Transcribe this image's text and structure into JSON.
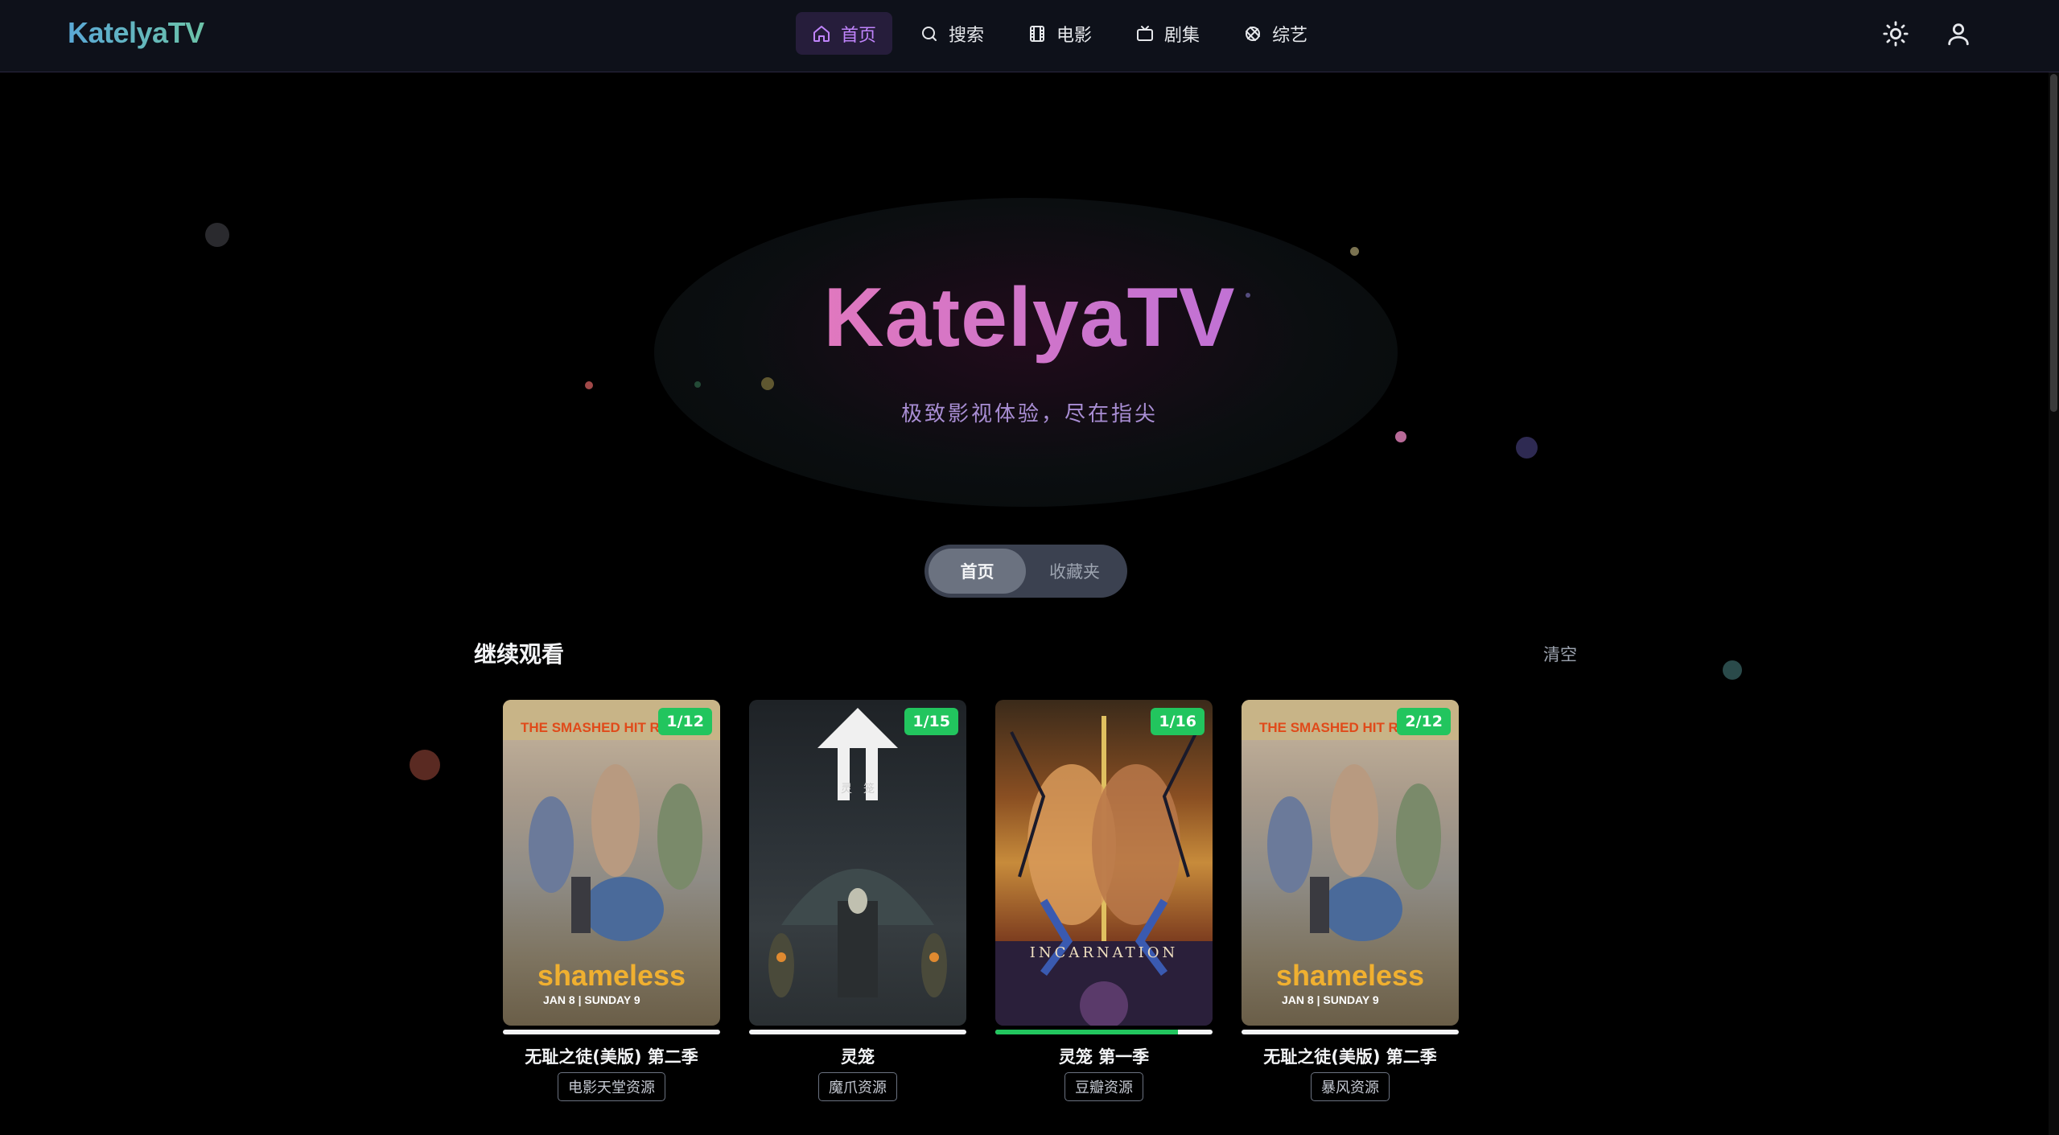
{
  "app": {
    "logo": "KatelyaTV"
  },
  "nav": {
    "items": [
      {
        "label": "首页",
        "icon": "home-icon",
        "active": true
      },
      {
        "label": "搜索",
        "icon": "search-icon",
        "active": false
      },
      {
        "label": "电影",
        "icon": "film-icon",
        "active": false
      },
      {
        "label": "剧集",
        "icon": "tv-icon",
        "active": false
      },
      {
        "label": "综艺",
        "icon": "variety-icon",
        "active": false
      }
    ],
    "theme_icon": "sun-icon",
    "user_icon": "user-icon"
  },
  "hero": {
    "title": "KatelyaTV",
    "subtitle": "极致影视体验，尽在指尖"
  },
  "tabs": {
    "home": "首页",
    "favorites": "收藏夹",
    "active": "home"
  },
  "continue_watching": {
    "title": "继续观看",
    "clear_label": "清空",
    "items": [
      {
        "title": "无耻之徒(美版) 第二季",
        "source": "电影天堂资源",
        "episode": "1/12",
        "progress": 0.0,
        "poster_text_top": "THE SMASHED HIT RET",
        "poster_text_main": "shameless",
        "poster_text_sub": "JAN 8 | SUNDAY 9"
      },
      {
        "title": "灵笼",
        "source": "魔爪资源",
        "episode": "1/15",
        "progress": 0.0,
        "poster_text_main": "灵　笼"
      },
      {
        "title": "灵笼 第一季",
        "source": "豆瓣资源",
        "episode": "1/16",
        "progress": 0.84,
        "poster_text_main": "INCARNATION"
      },
      {
        "title": "无耻之徒(美版) 第二季",
        "source": "暴风资源",
        "episode": "2/12",
        "progress": 0.0,
        "poster_text_top": "THE SMASHED HIT RE",
        "poster_text_main": "shameless",
        "poster_text_sub": "JAN 8 | SUNDAY 9"
      }
    ]
  },
  "colors": {
    "accent": "#c084fc",
    "badge": "#22c55e",
    "background": "#000000",
    "topbar": "#0e111a"
  }
}
